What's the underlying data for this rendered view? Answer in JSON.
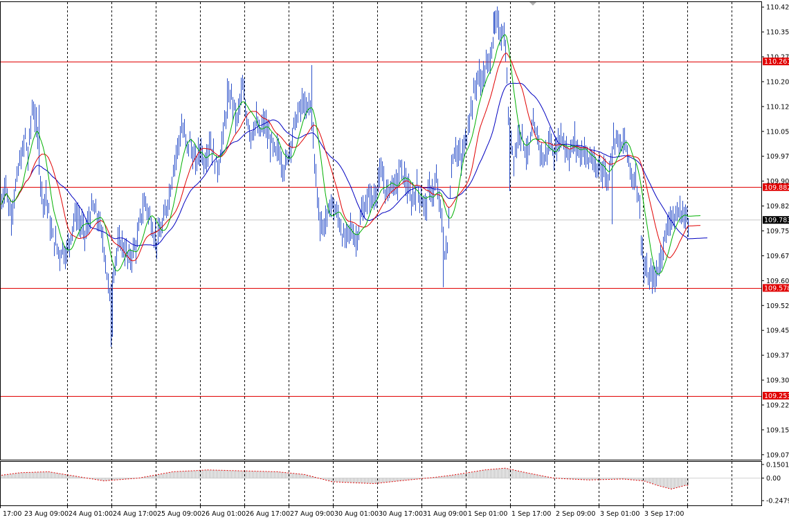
{
  "chart_data": [
    {
      "type": "line",
      "panel": "price",
      "ylim": [
        109.06,
        110.44
      ],
      "grid": true,
      "y_ticks": [
        "110.425",
        "110.350",
        "110.275",
        "110.200",
        "110.125",
        "110.050",
        "109.975",
        "109.900",
        "109.825",
        "109.750",
        "109.675",
        "109.600",
        "109.525",
        "109.450",
        "109.375",
        "109.300",
        "109.225",
        "109.150",
        "109.075"
      ],
      "x_ticks": [
        "17:00",
        "23 Aug 09:00",
        "24 Aug 01:00",
        "24 Aug 17:00",
        "25 Aug 09:00",
        "26 Aug 01:00",
        "26 Aug 17:00",
        "27 Aug 09:00",
        "30 Aug 01:00",
        "30 Aug 17:00",
        "31 Aug 09:00",
        "1 Sep 01:00",
        "1 Sep 17:00",
        "2 Sep 09:00",
        "3 Sep 01:00",
        "3 Sep 17:00"
      ],
      "levels": [
        {
          "label": "110.261",
          "value": 110.261,
          "color": "#e00000"
        },
        {
          "label": "109.882",
          "value": 109.882,
          "color": "#e00000"
        },
        {
          "label": "109.578",
          "value": 109.578,
          "color": "#e00000"
        },
        {
          "label": "109.253",
          "value": 109.253,
          "color": "#e00000"
        }
      ],
      "current_price": {
        "label": "109.783",
        "value": 109.783,
        "color": "#000000"
      },
      "colors": {
        "bars": "#2a4fc9",
        "fast_ma": "#00b000",
        "mid_ma": "#e00000",
        "slow_ma": "#0000c0",
        "grid": "#000000",
        "level": "#e00000"
      },
      "anchors": [
        [
          0,
          109.8
        ],
        [
          4,
          109.86
        ],
        [
          8,
          109.9
        ],
        [
          12,
          109.82
        ],
        [
          16,
          109.8
        ],
        [
          20,
          109.86
        ],
        [
          24,
          109.9
        ],
        [
          28,
          109.96
        ],
        [
          32,
          109.98
        ],
        [
          36,
          110.04
        ],
        [
          40,
          109.97
        ],
        [
          46,
          110.12
        ],
        [
          50,
          110.1
        ],
        [
          54,
          110.02
        ],
        [
          58,
          109.9
        ],
        [
          62,
          109.84
        ],
        [
          66,
          109.86
        ],
        [
          70,
          109.8
        ],
        [
          74,
          109.74
        ],
        [
          78,
          109.72
        ],
        [
          82,
          109.7
        ],
        [
          86,
          109.68
        ],
        [
          90,
          109.7
        ],
        [
          94,
          109.68
        ],
        [
          98,
          109.7
        ],
        [
          102,
          109.74
        ],
        [
          106,
          109.78
        ],
        [
          110,
          109.8
        ],
        [
          114,
          109.78
        ],
        [
          118,
          109.76
        ],
        [
          122,
          109.74
        ],
        [
          126,
          109.76
        ],
        [
          130,
          109.8
        ],
        [
          134,
          109.82
        ],
        [
          138,
          109.8
        ],
        [
          142,
          109.78
        ],
        [
          146,
          109.74
        ],
        [
          150,
          109.7
        ],
        [
          154,
          109.62
        ],
        [
          158,
          109.55
        ],
        [
          162,
          109.6
        ],
        [
          166,
          109.66
        ],
        [
          170,
          109.7
        ],
        [
          174,
          109.72
        ],
        [
          178,
          109.7
        ],
        [
          182,
          109.68
        ],
        [
          186,
          109.66
        ],
        [
          190,
          109.68
        ],
        [
          194,
          109.7
        ],
        [
          198,
          109.72
        ],
        [
          202,
          109.78
        ],
        [
          206,
          109.82
        ],
        [
          210,
          109.84
        ],
        [
          214,
          109.8
        ],
        [
          218,
          109.78
        ],
        [
          222,
          109.74
        ],
        [
          226,
          109.72
        ],
        [
          230,
          109.74
        ],
        [
          234,
          109.76
        ],
        [
          238,
          109.8
        ],
        [
          242,
          109.84
        ],
        [
          246,
          109.88
        ],
        [
          250,
          109.94
        ],
        [
          254,
          109.98
        ],
        [
          258,
          110.02
        ],
        [
          262,
          110.06
        ],
        [
          266,
          110.04
        ],
        [
          270,
          110.0
        ],
        [
          274,
          110.02
        ],
        [
          278,
          109.98
        ],
        [
          282,
          109.95
        ],
        [
          286,
          109.98
        ],
        [
          290,
          110.0
        ],
        [
          294,
          109.96
        ],
        [
          298,
          109.98
        ],
        [
          302,
          110.02
        ],
        [
          306,
          110.0
        ],
        [
          310,
          109.96
        ],
        [
          314,
          109.94
        ],
        [
          318,
          109.98
        ],
        [
          322,
          110.04
        ],
        [
          326,
          110.1
        ],
        [
          330,
          110.14
        ],
        [
          334,
          110.16
        ],
        [
          338,
          110.12
        ],
        [
          342,
          110.08
        ],
        [
          346,
          110.14
        ],
        [
          350,
          110.18
        ],
        [
          354,
          110.12
        ],
        [
          358,
          110.08
        ],
        [
          362,
          110.04
        ],
        [
          366,
          110.06
        ],
        [
          370,
          110.08
        ],
        [
          374,
          110.04
        ],
        [
          378,
          110.06
        ],
        [
          382,
          110.08
        ],
        [
          386,
          110.04
        ],
        [
          390,
          110.02
        ],
        [
          394,
          110.0
        ],
        [
          398,
          109.98
        ],
        [
          402,
          110.0
        ],
        [
          406,
          109.96
        ],
        [
          410,
          109.94
        ],
        [
          414,
          109.96
        ],
        [
          418,
          110.0
        ],
        [
          422,
          110.04
        ],
        [
          426,
          110.08
        ],
        [
          430,
          110.1
        ],
        [
          434,
          110.12
        ],
        [
          438,
          110.14
        ],
        [
          442,
          110.1
        ],
        [
          446,
          110.14
        ],
        [
          450,
          110.1
        ],
        [
          454,
          109.96
        ],
        [
          458,
          109.86
        ],
        [
          462,
          109.78
        ],
        [
          466,
          109.76
        ],
        [
          470,
          109.78
        ],
        [
          474,
          109.8
        ],
        [
          478,
          109.84
        ],
        [
          482,
          109.82
        ],
        [
          486,
          109.8
        ],
        [
          490,
          109.78
        ],
        [
          494,
          109.74
        ],
        [
          498,
          109.72
        ],
        [
          502,
          109.74
        ],
        [
          506,
          109.76
        ],
        [
          510,
          109.74
        ],
        [
          514,
          109.72
        ],
        [
          518,
          109.76
        ],
        [
          522,
          109.8
        ],
        [
          526,
          109.82
        ],
        [
          530,
          109.84
        ],
        [
          534,
          109.86
        ],
        [
          538,
          109.84
        ],
        [
          542,
          109.86
        ],
        [
          546,
          109.9
        ],
        [
          550,
          109.92
        ],
        [
          554,
          109.9
        ],
        [
          558,
          109.86
        ],
        [
          562,
          109.88
        ],
        [
          566,
          109.9
        ],
        [
          570,
          109.88
        ],
        [
          574,
          109.9
        ],
        [
          578,
          109.94
        ],
        [
          582,
          109.92
        ],
        [
          586,
          109.9
        ],
        [
          590,
          109.86
        ],
        [
          594,
          109.84
        ],
        [
          598,
          109.86
        ],
        [
          602,
          109.88
        ],
        [
          606,
          109.86
        ],
        [
          610,
          109.84
        ],
        [
          614,
          109.82
        ],
        [
          618,
          109.86
        ],
        [
          622,
          109.88
        ],
        [
          626,
          109.86
        ],
        [
          630,
          109.9
        ],
        [
          634,
          109.84
        ],
        [
          638,
          109.78
        ],
        [
          642,
          109.68
        ],
        [
          646,
          109.7
        ],
        [
          650,
          109.88
        ],
        [
          654,
          109.98
        ],
        [
          658,
          110.0
        ],
        [
          662,
          109.98
        ],
        [
          666,
          109.96
        ],
        [
          670,
          110.0
        ],
        [
          674,
          110.04
        ],
        [
          678,
          110.1
        ],
        [
          682,
          110.14
        ],
        [
          686,
          110.18
        ],
        [
          690,
          110.22
        ],
        [
          694,
          110.2
        ],
        [
          698,
          110.22
        ],
        [
          702,
          110.24
        ],
        [
          706,
          110.26
        ],
        [
          710,
          110.3
        ],
        [
          714,
          110.36
        ],
        [
          718,
          110.38
        ],
        [
          722,
          110.34
        ],
        [
          726,
          110.36
        ],
        [
          730,
          110.3
        ],
        [
          734,
          110.1
        ],
        [
          738,
          110.02
        ],
        [
          742,
          109.98
        ],
        [
          746,
          110.0
        ],
        [
          750,
          110.06
        ],
        [
          754,
          110.04
        ],
        [
          758,
          110.0
        ],
        [
          762,
          109.98
        ],
        [
          766,
          110.02
        ],
        [
          770,
          110.06
        ],
        [
          774,
          110.04
        ],
        [
          778,
          110.02
        ],
        [
          782,
          109.98
        ],
        [
          786,
          109.96
        ],
        [
          790,
          110.0
        ],
        [
          794,
          110.02
        ],
        [
          798,
          110.0
        ],
        [
          802,
          109.98
        ],
        [
          806,
          110.02
        ],
        [
          810,
          110.04
        ],
        [
          814,
          110.02
        ],
        [
          818,
          110.0
        ],
        [
          822,
          109.98
        ],
        [
          826,
          110.0
        ],
        [
          830,
          110.02
        ],
        [
          834,
          110.0
        ],
        [
          838,
          109.98
        ],
        [
          842,
          110.0
        ],
        [
          846,
          109.98
        ],
        [
          850,
          109.96
        ],
        [
          854,
          109.98
        ],
        [
          858,
          109.94
        ],
        [
          862,
          109.92
        ],
        [
          866,
          109.96
        ],
        [
          870,
          109.94
        ],
        [
          874,
          109.92
        ],
        [
          878,
          109.9
        ],
        [
          882,
          109.98
        ],
        [
          886,
          110.02
        ],
        [
          890,
          110.04
        ],
        [
          894,
          110.02
        ],
        [
          898,
          110.0
        ],
        [
          902,
          110.02
        ],
        [
          906,
          109.98
        ],
        [
          910,
          109.94
        ],
        [
          914,
          109.9
        ],
        [
          918,
          109.92
        ],
        [
          922,
          109.86
        ],
        [
          926,
          109.74
        ],
        [
          930,
          109.64
        ],
        [
          934,
          109.62
        ],
        [
          938,
          109.6
        ],
        [
          942,
          109.62
        ],
        [
          946,
          109.6
        ],
        [
          950,
          109.64
        ],
        [
          954,
          109.66
        ],
        [
          958,
          109.72
        ],
        [
          962,
          109.74
        ],
        [
          966,
          109.78
        ],
        [
          970,
          109.8
        ],
        [
          974,
          109.78
        ],
        [
          978,
          109.8
        ],
        [
          982,
          109.81
        ],
        [
          986,
          109.8
        ],
        [
          990,
          109.79
        ],
        [
          994,
          109.79
        ]
      ],
      "spikes": [
        [
          56,
          110.13
        ],
        [
          160,
          109.4
        ],
        [
          162,
          109.43
        ],
        [
          328,
          110.21
        ],
        [
          450,
          110.25
        ],
        [
          640,
          109.58
        ],
        [
          713,
          110.41
        ],
        [
          736,
          109.87
        ],
        [
          884,
          109.77
        ],
        [
          944,
          109.58
        ]
      ]
    },
    {
      "type": "line",
      "panel": "oscillator",
      "ylim": [
        -0.3,
        0.18
      ],
      "y_ticks": [
        "0.1501",
        "0.00",
        "-0.2479"
      ],
      "anchors": [
        [
          0,
          0.03
        ],
        [
          30,
          0.06
        ],
        [
          70,
          0.07
        ],
        [
          110,
          0.02
        ],
        [
          150,
          -0.03
        ],
        [
          200,
          0.0
        ],
        [
          250,
          0.07
        ],
        [
          300,
          0.09
        ],
        [
          350,
          0.08
        ],
        [
          400,
          0.07
        ],
        [
          440,
          0.04
        ],
        [
          480,
          -0.04
        ],
        [
          540,
          -0.06
        ],
        [
          590,
          -0.02
        ],
        [
          630,
          0.01
        ],
        [
          660,
          0.04
        ],
        [
          700,
          0.09
        ],
        [
          730,
          0.11
        ],
        [
          760,
          0.06
        ],
        [
          800,
          0.0
        ],
        [
          850,
          -0.02
        ],
        [
          900,
          -0.01
        ],
        [
          930,
          -0.03
        ],
        [
          950,
          -0.08
        ],
        [
          970,
          -0.12
        ],
        [
          990,
          -0.08
        ]
      ]
    }
  ]
}
